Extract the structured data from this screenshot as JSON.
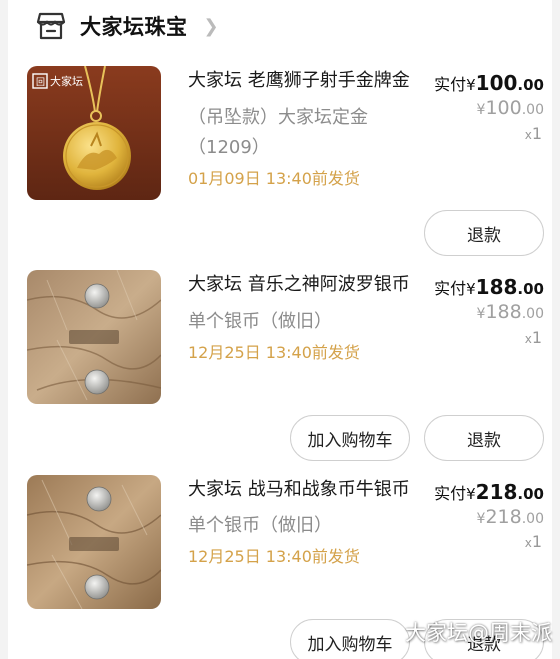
{
  "shop": {
    "name": "大家坛珠宝",
    "icon": "store-icon"
  },
  "orders": [
    {
      "title": "大家坛 老鹰狮子射手金牌金",
      "spec": "（吊坠款）大家坛定金（1209）",
      "ship": "01月09日 13:40前发货",
      "paid_label": "实付",
      "currency": "¥",
      "paid_int": "100",
      "paid_dec": ".00",
      "orig_int": "100",
      "orig_dec": ".00",
      "qty_x": "x",
      "qty": "1",
      "thumb_logo": "大家坛",
      "buttons": {
        "refund": "退款"
      }
    },
    {
      "title": "大家坛  音乐之神阿波罗银币",
      "spec": "单个银币（做旧）",
      "ship": "12月25日 13:40前发货",
      "paid_label": "实付",
      "currency": "¥",
      "paid_int": "188",
      "paid_dec": ".00",
      "orig_int": "188",
      "orig_dec": ".00",
      "qty_x": "x",
      "qty": "1",
      "buttons": {
        "cart": "加入购物车",
        "refund": "退款"
      }
    },
    {
      "title": "大家坛  战马和战象币牛银币",
      "spec": "单个银币（做旧）",
      "ship": "12月25日 13:40前发货",
      "paid_label": "实付",
      "currency": "¥",
      "paid_int": "218",
      "paid_dec": ".00",
      "orig_int": "218",
      "orig_dec": ".00",
      "qty_x": "x",
      "qty": "1",
      "buttons": {
        "cart": "加入购物车",
        "refund": "退款"
      }
    }
  ],
  "watermark": "大家坛@周末派",
  "colors": {
    "ship_text": "#d4a24a",
    "card_bg": "#ffffff",
    "page_bg": "#f3f3f3"
  }
}
